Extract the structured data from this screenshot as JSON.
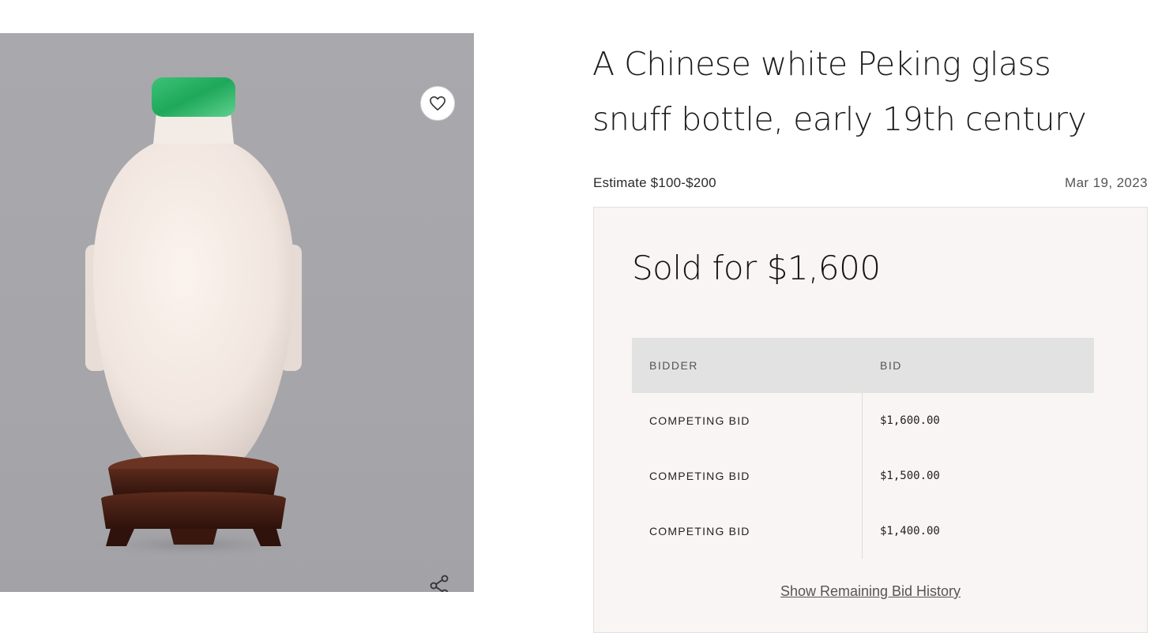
{
  "lot": {
    "title": "A Chinese white Peking glass snuff bottle, early 19th century",
    "estimate": "Estimate $100-$200",
    "date": "Mar 19, 2023"
  },
  "image": {
    "favorite_icon": "heart-icon",
    "share_icon": "share-icon",
    "colors": {
      "background": "#a8a8ac",
      "bottle": "#f5ede8",
      "stopper": "#2fb56a",
      "stand": "#4a1f14"
    }
  },
  "result": {
    "sold_label": "Sold for $1,600"
  },
  "bids": {
    "headers": {
      "bidder": "BIDDER",
      "bid": "BID"
    },
    "rows": [
      {
        "bidder": "COMPETING BID",
        "bid": "$1,600.00"
      },
      {
        "bidder": "COMPETING BID",
        "bid": "$1,500.00"
      },
      {
        "bidder": "COMPETING BID",
        "bid": "$1,400.00"
      }
    ],
    "show_more": "Show Remaining Bid History"
  }
}
